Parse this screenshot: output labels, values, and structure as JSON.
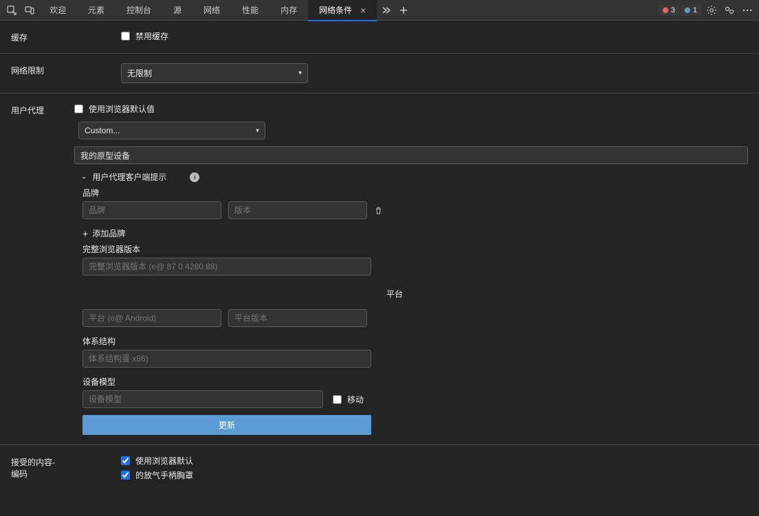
{
  "toolbar": {
    "tabs": {
      "welcome": "欢迎",
      "elements": "元素",
      "console": "控制台",
      "sources": "源",
      "network": "网络",
      "performance": "性能",
      "memory": "内存",
      "network_conditions": "网络条件"
    },
    "error_count": "3",
    "info_count": "1"
  },
  "cache": {
    "label": "缓存",
    "disable_cache": "禁用缓存"
  },
  "throttle": {
    "label": "网络限制",
    "value": "无限制"
  },
  "ua": {
    "label": "用户代理",
    "use_default": "使用浏览器默认值",
    "preset": "Custom...",
    "ua_string": "我的原型设备",
    "hints_title": "用户代理客户端提示",
    "brand_label": "品牌",
    "brand_placeholder": "品牌",
    "version_placeholder": "版本",
    "add_brand": "添加品牌",
    "full_version_label": "完整浏览器版本",
    "full_version_placeholder": "完整浏览器版本 (e@ 87 0 4280 88)",
    "platform_label": "平台",
    "platform_placeholder": "平台 (e@ Android)",
    "platform_version_placeholder": "平台版本",
    "arch_label": "体系结构",
    "arch_placeholder": "体系结构蛋 x86)",
    "device_model_label": "设备模型",
    "device_model_placeholder": "设备模型",
    "mobile_label": "移动",
    "update_label": "更新"
  },
  "encodings": {
    "label_line1": "接受的内容-",
    "label_line2": "编码",
    "use_default": "使用浏览器默认",
    "deflate_text": "的放气手柄胸罩"
  }
}
